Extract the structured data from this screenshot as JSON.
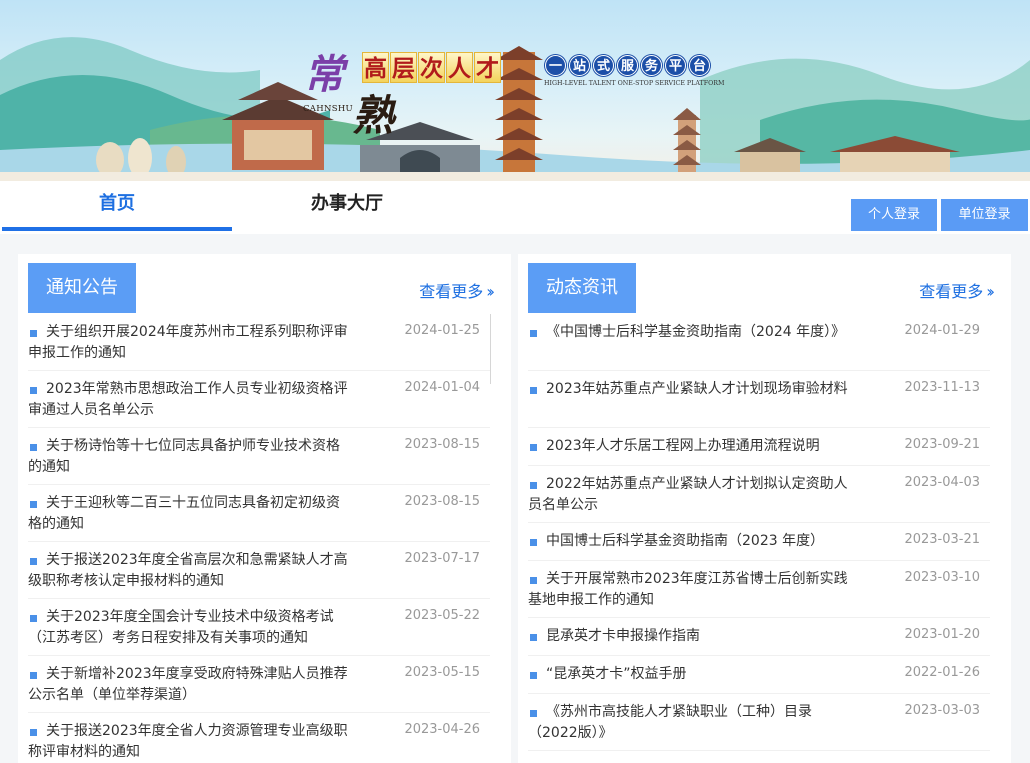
{
  "banner": {
    "logo_chang": "常",
    "logo_shu": "熟",
    "logo_cahnshu": "CAHNSHU",
    "logo_talent_chars": [
      "高",
      "层",
      "次",
      "人",
      "才"
    ],
    "logo_onestop_chars": [
      "一",
      "站",
      "式",
      "服",
      "务",
      "平",
      "台"
    ],
    "logo_english": "HIGH-LEVEL TALENT ONE-STOP SERVICE PLATFORM"
  },
  "nav": {
    "tabs": [
      {
        "label": "首页",
        "active": true
      },
      {
        "label": "办事大厅",
        "active": false
      }
    ],
    "personal_login": "个人登录",
    "unit_login": "单位登录"
  },
  "notices": {
    "heading": "通知公告",
    "more": "查看更多",
    "items": [
      {
        "title": "关于组织开展2024年度苏州市工程系列职称评审申报工作的通知",
        "date": "2024-01-25"
      },
      {
        "title": "2023年常熟市思想政治工作人员专业初级资格评审通过人员名单公示",
        "date": "2024-01-04"
      },
      {
        "title": "关于杨诗怡等十七位同志具备护师专业技术资格的通知",
        "date": "2023-08-15"
      },
      {
        "title": "关于王迎秋等二百三十五位同志具备初定初级资格的通知",
        "date": "2023-08-15"
      },
      {
        "title": "关于报送2023年度全省高层次和急需紧缺人才高级职称考核认定申报材料的通知",
        "date": "2023-07-17"
      },
      {
        "title": "关于2023年度全国会计专业技术中级资格考试（江苏考区）考务日程安排及有关事项的通知",
        "date": "2023-05-22"
      },
      {
        "title": "关于新增补2023年度享受政府特殊津贴人员推荐公示名单（单位举荐渠道）",
        "date": "2023-05-15"
      },
      {
        "title": "关于报送2023年度全省人力资源管理专业高级职称评审材料的通知",
        "date": "2023-04-26"
      }
    ]
  },
  "news": {
    "heading": "动态资讯",
    "more": "查看更多",
    "items": [
      {
        "title": "《中国博士后科学基金资助指南（2024 年度）》",
        "date": "2024-01-29"
      },
      {
        "title": "2023年姑苏重点产业紧缺人才计划现场审验材料",
        "date": "2023-11-13"
      },
      {
        "title": "2023年人才乐居工程网上办理通用流程说明",
        "date": "2023-09-21"
      },
      {
        "title": "2022年姑苏重点产业紧缺人才计划拟认定资助人员名单公示",
        "date": "2023-04-03"
      },
      {
        "title": "中国博士后科学基金资助指南（2023 年度）",
        "date": "2023-03-21"
      },
      {
        "title": "关于开展常熟市2023年度江苏省博士后创新实践基地申报工作的通知",
        "date": "2023-03-10"
      },
      {
        "title": "昆承英才卡申报操作指南",
        "date": "2023-01-20"
      },
      {
        "title": "“昆承英才卡”权益手册",
        "date": "2022-01-26"
      },
      {
        "title": "《苏州市高技能人才紧缺职业（工种）目录（2022版）》",
        "date": "2023-03-03"
      }
    ]
  }
}
